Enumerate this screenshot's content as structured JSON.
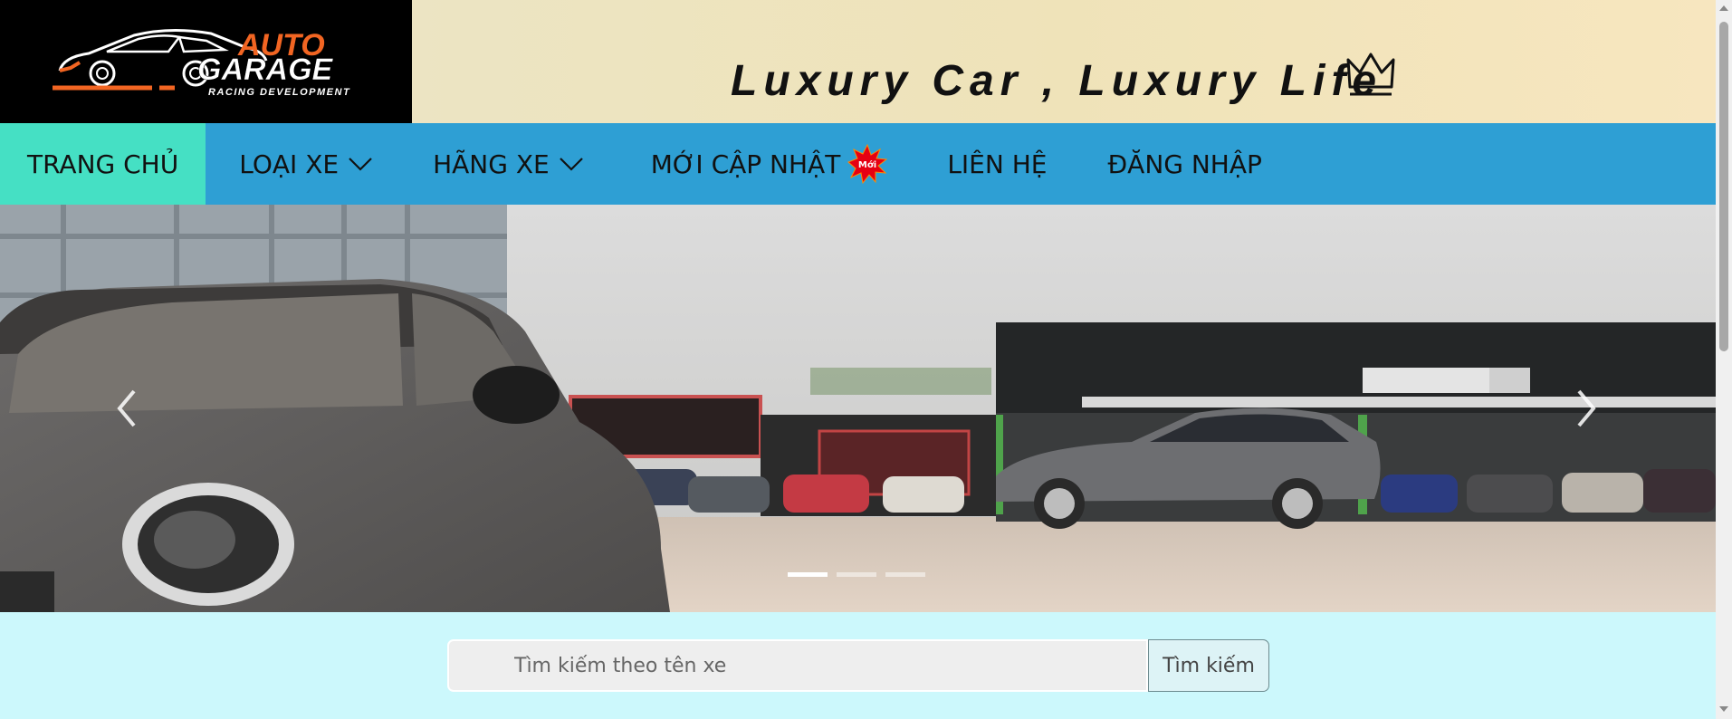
{
  "logo": {
    "line1": "AUTO",
    "line2": "GARAGE",
    "tagline": "RACING DEVELOPMENT",
    "icon": "car-silhouette-icon"
  },
  "banner": {
    "slogan": "Luxury Car , Luxury Life",
    "icon": "crown-icon"
  },
  "nav": {
    "home": "TRANG CHỦ",
    "car_types": "LOẠI XE",
    "brands": "HÃNG XE",
    "new_updates": "MỚI CẬP NHẬT",
    "new_badge": "Mới",
    "contact": "LIÊN HỆ",
    "login": "ĐĂNG NHẬP"
  },
  "carousel": {
    "slide_count": 3,
    "active_index": 0,
    "prev_icon": "chevron-left-icon",
    "next_icon": "chevron-right-icon"
  },
  "search": {
    "placeholder": "Tìm kiếm theo tên xe",
    "value": "",
    "button": "Tìm kiếm"
  },
  "colors": {
    "nav_bg": "#2e9fd4",
    "nav_active": "#45e0c4",
    "page_bg": "#ccf8fc",
    "logo_accent": "#f26522"
  }
}
